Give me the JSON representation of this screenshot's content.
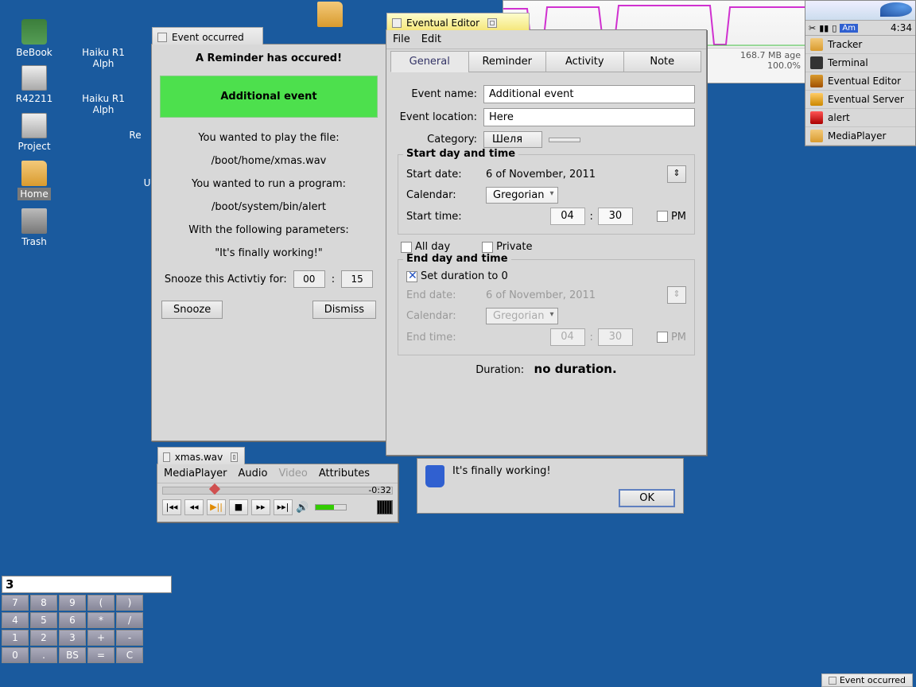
{
  "desktop": {
    "icons": [
      {
        "label": "BeBook"
      },
      {
        "label": "R42211"
      },
      {
        "label": "Project"
      },
      {
        "label": "Home"
      },
      {
        "label": "Trash"
      },
      {
        "label": "Haiku R1 Alph"
      },
      {
        "label": "Haiku R1 Alph"
      },
      {
        "label": "Re"
      },
      {
        "label": "U"
      }
    ]
  },
  "event_window": {
    "title": "Event occurred",
    "headline": "A Reminder has occured!",
    "event_name": "Additional event",
    "lines": {
      "play_label": "You wanted to play the file:",
      "play_path": "/boot/home/xmas.wav",
      "run_label": "You wanted to run a program:",
      "run_path": "/boot/system/bin/alert",
      "params_label": "With the following parameters:",
      "params_value": "\"It's finally working!\""
    },
    "snooze_label": "Snooze this Activtiy for:",
    "snooze_h": "00",
    "snooze_m": "15",
    "snooze_btn": "Snooze",
    "dismiss_btn": "Dismiss"
  },
  "editor": {
    "title": "Eventual Editor",
    "menu": {
      "file": "File",
      "edit": "Edit"
    },
    "tabs": {
      "general": "General",
      "reminder": "Reminder",
      "activity": "Activity",
      "note": "Note"
    },
    "labels": {
      "eventname": "Event name:",
      "eventloc": "Event location:",
      "category": "Category:"
    },
    "values": {
      "eventname": "Additional event",
      "eventloc": "Here",
      "category": "Шеля"
    },
    "start": {
      "group": "Start day and time",
      "date_l": "Start date:",
      "date_v": "6 of November, 2011",
      "cal_l": "Calendar:",
      "cal_v": "Gregorian",
      "time_l": "Start time:",
      "time_h": "04",
      "time_m": "30",
      "pm": "PM"
    },
    "allday": "All day",
    "private": "Private",
    "end": {
      "group": "End day and time",
      "setdur": "Set duration to 0",
      "date_l": "End date:",
      "date_v": "6 of November, 2011",
      "cal_l": "Calendar:",
      "cal_v": "Gregorian",
      "time_l": "End time:",
      "time_h": "04",
      "time_m": "30",
      "pm": "PM"
    },
    "duration_l": "Duration:",
    "duration_v": "no duration."
  },
  "alert": {
    "text": "It's finally working!",
    "ok": "OK"
  },
  "media": {
    "title": "xmas.wav",
    "menu": {
      "mp": "MediaPlayer",
      "audio": "Audio",
      "video": "Video",
      "attr": "Attributes"
    },
    "time": "-0:32"
  },
  "deskbar": {
    "clock": "4:34",
    "am": "Am",
    "apps": [
      {
        "label": "Tracker"
      },
      {
        "label": "Terminal"
      },
      {
        "label": "Eventual Editor"
      },
      {
        "label": "Eventual Server"
      },
      {
        "label": "alert"
      },
      {
        "label": "MediaPlayer"
      }
    ]
  },
  "actmon": {
    "line1": "168.7 MB      age",
    "line2": "100.0%"
  },
  "calc": {
    "display": "3",
    "keys": [
      "7",
      "8",
      "9",
      "(",
      ")",
      "",
      "4",
      "5",
      "6",
      "*",
      "/",
      "",
      "1",
      "2",
      "3",
      "+",
      "-",
      "",
      "0",
      ".",
      "BS",
      "=",
      "C",
      ""
    ]
  },
  "minitab": "Event occurred"
}
